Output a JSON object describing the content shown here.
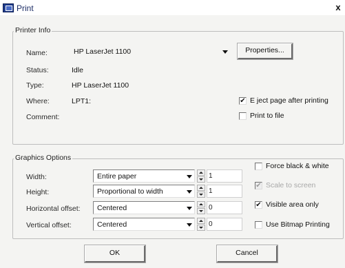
{
  "window": {
    "title": "Print",
    "close_glyph": "x",
    "icon": "printer-icon"
  },
  "printer_info": {
    "group_title": "Printer Info",
    "name_label": "Name:",
    "name_value": "HP LaserJet 1100",
    "properties_button": "Properties...",
    "status_label": "Status:",
    "status_value": "Idle",
    "type_label": "Type:",
    "type_value": "HP LaserJet 1100",
    "where_label": "Where:",
    "where_value": "LPT1:",
    "comment_label": "Comment:",
    "comment_value": "",
    "eject_label": "E ject page after printing",
    "eject_checked": true,
    "eject_mark": "✔",
    "print_to_file_label": "Print to file",
    "print_to_file_checked": false
  },
  "graphics_options": {
    "group_title": "Graphics Options",
    "width_label": "Width:",
    "width_value": "Entire paper",
    "width_spin": "1",
    "height_label": "Height:",
    "height_value": "Proportional to width",
    "height_spin": "1",
    "hoffset_label": "Horizontal offset:",
    "hoffset_value": "Centered",
    "hoffset_spin": "0",
    "voffset_label": "Vertical offset:",
    "voffset_value": "Centered",
    "voffset_spin": "0",
    "force_bw_label": "Force black & white",
    "force_bw_checked": false,
    "scale_to_screen_label": "Scale to screen",
    "scale_to_screen_checked": true,
    "scale_to_screen_enabled": false,
    "scale_mark": "✔",
    "visible_area_label": "Visible area only",
    "visible_area_checked": true,
    "visible_area_mark": "✔",
    "bitmap_label": "Use Bitmap Printing",
    "bitmap_checked": false
  },
  "footer": {
    "ok_label": "OK",
    "cancel_label": "Cancel"
  },
  "colors": {
    "title_text": "#1d2d66",
    "dialog_bg": "#f4f4f2",
    "disabled_text": "#a8a8a8"
  }
}
